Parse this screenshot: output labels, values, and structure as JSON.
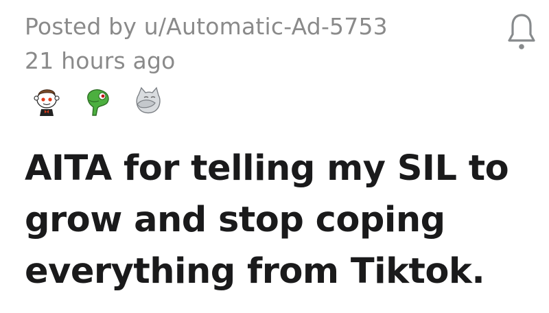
{
  "post": {
    "posted_by": "Posted by u/Automatic-Ad-5753",
    "age": "21 hours ago",
    "awards": [
      {
        "icon": "wholesome-award-icon"
      },
      {
        "icon": "dinosaur-award-icon"
      },
      {
        "icon": "facepalm-award-icon"
      }
    ],
    "title_lines": [
      "AITA for telling my SIL to",
      "grow and stop coping",
      "everything from Tiktok."
    ],
    "notification_icon": "bell-icon"
  }
}
